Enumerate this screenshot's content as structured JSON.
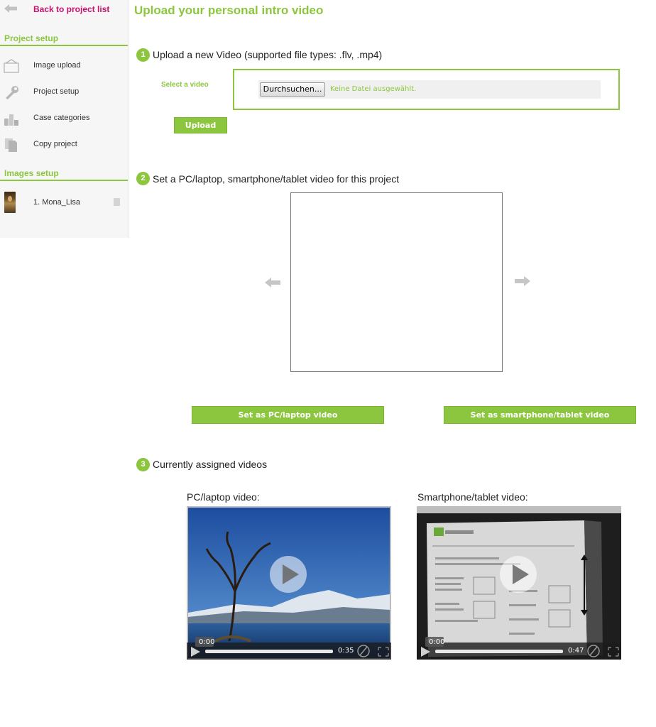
{
  "sidebar": {
    "back_label": "Back to project list",
    "section_project_setup": "Project setup",
    "nav_items": [
      {
        "label": "Image upload",
        "icon": "image-frame-icon"
      },
      {
        "label": "Project setup",
        "icon": "wrench-icon"
      },
      {
        "label": "Case categories",
        "icon": "bar-chart-icon"
      },
      {
        "label": "Copy project",
        "icon": "copy-document-icon"
      }
    ],
    "section_images_setup": "Images setup",
    "images": [
      {
        "label": "1. Mona_Lisa"
      }
    ]
  },
  "main": {
    "title": "Upload your personal intro video",
    "step1": {
      "number": "1",
      "text": "Upload a new Video (supported file types: .flv, .mp4)",
      "select_label": "Select a video",
      "browse_label": "Durchsuchen...",
      "no_file_text": "Keine Datei ausgewählt.",
      "upload_label": "Upload"
    },
    "step2": {
      "number": "2",
      "text": "Set a PC/laptop, smartphone/tablet video for this project",
      "pc_button": "Set as PC/laptop video",
      "mobile_button": "Set as smartphone/tablet video"
    },
    "step3": {
      "number": "3",
      "text": "Currently assigned videos",
      "pc_label": "PC/laptop video:",
      "pc_current": "0:00",
      "pc_duration": "0:35",
      "mobile_label": "Smartphone/tablet video:",
      "mobile_current": "0:00",
      "mobile_duration": "0:47"
    }
  },
  "colors": {
    "accent_green": "#8cc63f",
    "link_magenta": "#c8106e"
  }
}
